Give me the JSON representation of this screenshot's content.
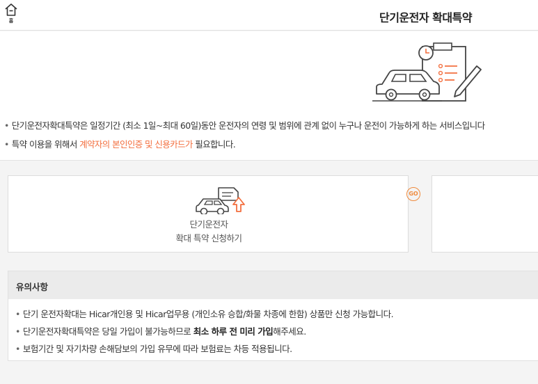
{
  "header": {
    "home_label": "홈",
    "title": "단기운전자 확대특약"
  },
  "intro": {
    "bullet1": "단기운전자확대특약은 일정기간 (최소 1일~최대 60일)동안 운전자의 연령 및 범위에 관계 없이 누구나 운전이 가능하게 하는 서비스입니다",
    "bullet2_pre": "특약 이용을 위해서 ",
    "bullet2_hl": "계약자의 본인인증 및 신용카드가",
    "bullet2_post": " 필요합니다."
  },
  "card": {
    "go_label": "GO",
    "line1": "단기운전자",
    "line2": "확대 특약 신청하기"
  },
  "notice": {
    "title": "유의사항",
    "item1": "단기 운전자확대는 Hicar개인용 및 Hicar업무용 (개인소유 승합/화물 차종에 한함) 상품만 신청 가능합니다.",
    "item2_pre": "단기운전자확대특약은 당일 가입이 불가능하므로 ",
    "item2_bold": "최소 하루 전 미리 가입",
    "item2_post": "해주세요.",
    "item3": "보험기간 및 자기차량 손해담보의 가입 유무에 따라 보험료는 차등 적용됩니다."
  },
  "colors": {
    "accent": "#f36f3f",
    "go_badge": "#f08a3c"
  },
  "icons": [
    "home-icon",
    "car-clipboard-illustration",
    "car-document-icon",
    "go-badge-icon"
  ]
}
